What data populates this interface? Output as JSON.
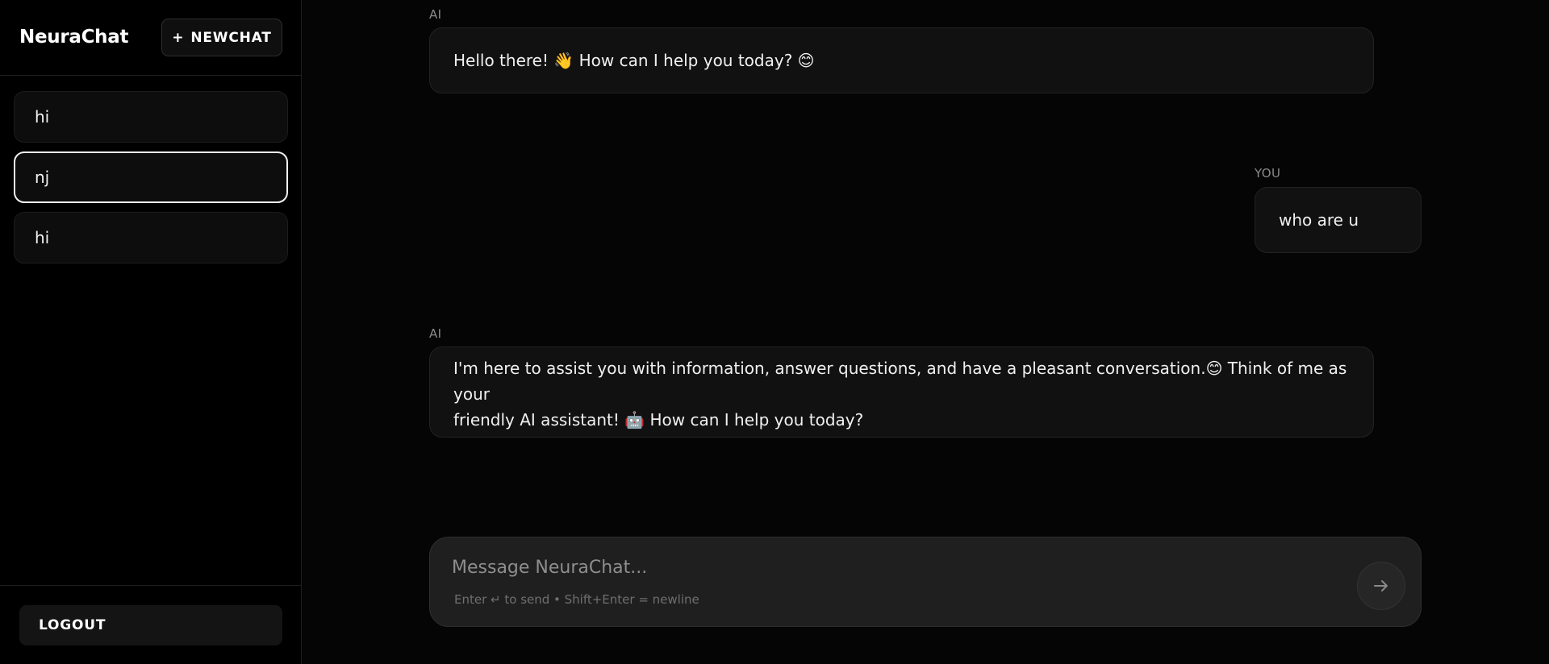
{
  "sidebar": {
    "brand": "NeuraChat",
    "new_chat_label": "NEWCHAT",
    "chats": [
      {
        "label": "hi",
        "active": false
      },
      {
        "label": "nj",
        "active": true
      },
      {
        "label": "hi",
        "active": false
      }
    ],
    "logout_label": "LOGOUT"
  },
  "messages": [
    {
      "role_label": "AI",
      "text_before": "Hello there! ",
      "emoji1": "👋",
      "text_mid": " How can I help you today? ",
      "emoji2": "😊"
    },
    {
      "role_label": "YOU",
      "text": "who are u"
    },
    {
      "role_label": "AI",
      "line1_text": "I'm here to assist you with information, answer questions, and have a pleasant conversation.",
      "emoji1": "😊",
      "line1_tail": " Think of me as your",
      "line2_text": "friendly AI assistant! ",
      "emoji2": "🤖",
      "line2_tail": " How can I help you today?"
    }
  ],
  "composer": {
    "placeholder": "Message NeuraChat...",
    "hint": "Enter ↵ to send • Shift+Enter = newline",
    "send_icon": "arrow-right-icon"
  },
  "colors": {
    "background": "#000000",
    "bubble": "#111111",
    "composer": "#1f1f1f",
    "active_border": "#f0f0f0"
  }
}
